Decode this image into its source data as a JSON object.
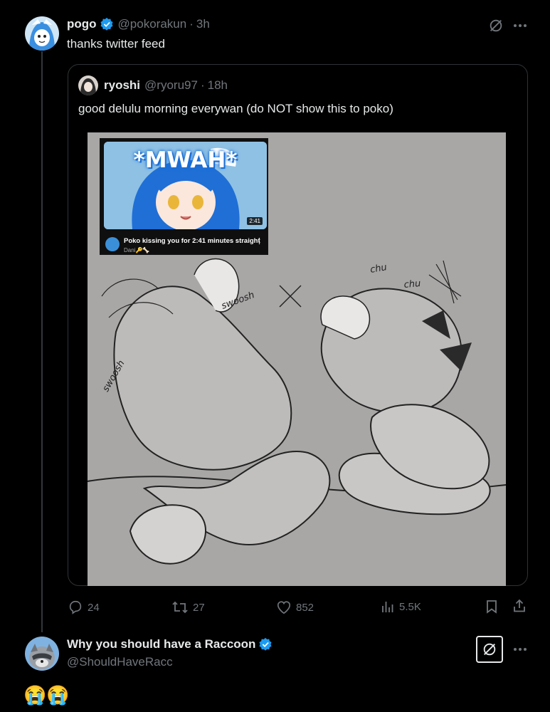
{
  "main_tweet": {
    "display_name": "pogo",
    "handle": "@pokorakun",
    "time": "3h",
    "text": "thanks twitter feed"
  },
  "quoted_tweet": {
    "display_name": "ryoshi",
    "handle": "@ryoru97",
    "time": "18h",
    "text": "good delulu morning everywan (do NOT show this to poko)",
    "media": {
      "youtube_card": {
        "overlay_text": "*MWAH*",
        "duration": "2:41",
        "title": "Poko kissing you for 2:41 minutes straight",
        "channel": "Dani🔑🦴"
      },
      "sketch_labels": [
        "chu",
        "chu",
        "swoosh",
        "swoosh"
      ]
    }
  },
  "actions": {
    "replies": "24",
    "reposts": "27",
    "likes": "852",
    "views": "5.5K"
  },
  "reply_tweet": {
    "display_name": "Why you should have a Raccoon",
    "handle": "@ShouldHaveRacc",
    "text": "😭😭"
  },
  "icons": {
    "verified": "verified-badge-icon",
    "more": "more-icon",
    "grok": "grok-icon",
    "reply": "reply-icon",
    "repost": "repost-icon",
    "like": "like-icon",
    "views": "views-icon",
    "bookmark": "bookmark-icon",
    "share": "share-icon"
  },
  "colors": {
    "background": "#000000",
    "text_primary": "#e7e9ea",
    "text_secondary": "#71767b",
    "verified": "#1d9bf0",
    "border": "#2f3336"
  }
}
